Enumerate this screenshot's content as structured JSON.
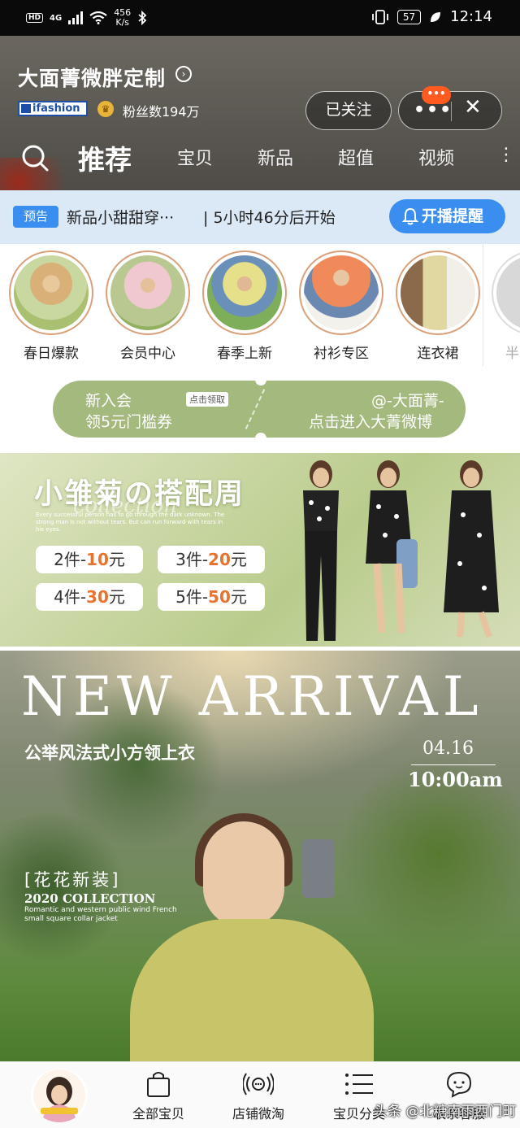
{
  "status_bar": {
    "hd": "HD",
    "signal": "4G",
    "speed_value": "456",
    "speed_unit": "K/s",
    "battery": "57",
    "time": "12:14"
  },
  "header": {
    "shop_name": "大面菁微胖定制",
    "brand": "ifashion",
    "fans": "粉丝数194万",
    "follow_label": "已关注",
    "more_glyph": "•••",
    "badge_glyph": "•••",
    "close_glyph": "✕",
    "tabs": {
      "recommend": "推荐",
      "items": "宝贝",
      "new": "新品",
      "value": "超值",
      "video": "视频",
      "more": "⋮"
    }
  },
  "preview": {
    "tag": "预告",
    "title": "新品小甜甜穿···",
    "time": "| 5小时46分后开始",
    "remind": "开播提醒"
  },
  "categories": [
    {
      "label": "春日爆款"
    },
    {
      "label": "会员中心"
    },
    {
      "label": "春季上新"
    },
    {
      "label": "衬衫专区"
    },
    {
      "label": "连衣裙"
    },
    {
      "label": "半"
    }
  ],
  "coupon": {
    "left_line1": "新入会",
    "left_line2": "领5元门槛券",
    "tag": "点击领取",
    "right_line1": "@-大面菁-",
    "right_line2": "点击进入大菁微博"
  },
  "banner1": {
    "title": "小雏菊の搭配周",
    "script": "collection",
    "sub": "Every successful person has to go through the dark unknown. The strong man is not without tears. But can run forward with tears in his eyes.",
    "deals": [
      {
        "qty": "2件-",
        "price": "10",
        "unit": "元"
      },
      {
        "qty": "3件-",
        "price": "20",
        "unit": "元"
      },
      {
        "qty": "4件-",
        "price": "30",
        "unit": "元"
      },
      {
        "qty": "5件-",
        "price": "50",
        "unit": "元"
      }
    ]
  },
  "banner2": {
    "headline": "NEW ARRIVAL",
    "sub": "公举风法式小方领上衣",
    "date": "04.16",
    "time": "10:00am",
    "tag": "[花花新装]",
    "collection": "2020 COLLECTION",
    "small": "Romantic and western public wind French small square collar jacket"
  },
  "bottom_nav": {
    "all_items": "全部宝贝",
    "weitao": "店铺微淘",
    "category": "宝贝分类",
    "contact": "联系客服"
  },
  "watermark": "头条 @北糖南雨西门町",
  "colors": {
    "accent_blue": "#3a8ef0",
    "coupon_green": "#a4b97e",
    "deal_orange": "#e8732f",
    "badge_orange": "#ff5a1f"
  }
}
